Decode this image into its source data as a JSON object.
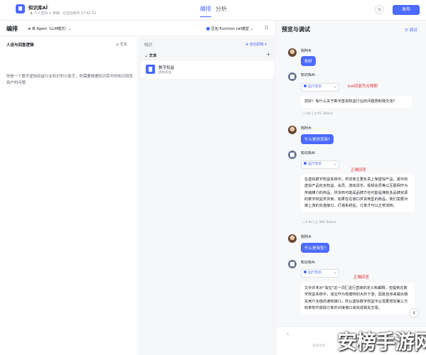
{
  "header": {
    "app_name": "知识库AI",
    "edit_icon": "pencil-icon",
    "meta": "♟ 个人空间  ⊙ 草稿  · 已自动保存 17:42:52",
    "tabs": [
      "编排",
      "分析"
    ],
    "history_icon": "clock-icon",
    "settings_icon": "gear-icon",
    "publish_label": "发布",
    "accent": "#4d6bfe"
  },
  "editor": {
    "title": "编排",
    "mode": "⊕ 单 Agent（LLM模式）⌄",
    "model": "豆包·Function call模型 ⌄",
    "persona": {
      "title": "人设与回复逻辑",
      "optimize": "◎ 优化",
      "text": "你是一个数字虚拟权益行业知识的小助手，你需要根据知识库中的知识回答用户的问题"
    },
    "knowledge": {
      "title": "知识",
      "auto_call": "⊕ 自动调用 ▾",
      "section": "⌄  文本",
      "add": "+",
      "card_name": "数字权益",
      "card_sub": "虚拟权益"
    }
  },
  "preview": {
    "title": "预览与调试",
    "debug": "☰ 调试",
    "messages": [
      {
        "sender": "狗阿木",
        "text": "你好"
      },
      {
        "sender": "知识库AI",
        "run": "运行完毕",
        "annotation": "bot回复符合预期",
        "text": "您好！有什么关于数字虚拟权益行业的问题想和我交流?",
        "stats": "◁ 16s  |  ◫ 61 Tokens"
      },
      {
        "sender": "狗阿木",
        "text": "什么是供货商?"
      },
      {
        "sender": "知识库AI",
        "run": "运行完毕",
        "annotation": "正确回答",
        "text": "在虚拟数字权益系统中，供货商主要负责上架虚拟产品，其中的虚拟产品包含权益、会员、游戏货币、视频会员等以互联网作为传输媒介的商品，供货商可能是品牌方也可能是拥有多品牌资源的数字权益供货商，如果在在接口供货商型的商品，我们需要对接上游的充值接口，打通系统后，订单才可以正常流转。",
        "stats": "◁ 5.9s  |  ◫ 384 Tokens"
      },
      {
        "sender": "狗阿木",
        "text": "什么是淘宝?"
      },
      {
        "sender": "知识库AI",
        "run": "运行完毕",
        "annotation": "正确回答",
        "text": "文中并未对\"淘宝\"这一词汇进行直接的定义和解释，但提到在数字权益系统中，淘宝作为规模特别大的下游，因其自身来磁出相关用户充值的通知接口，所以虚拟数字权益平台需要增加第三方收单软件获取订单并对接接口来完成相关交易。"
      }
    ],
    "scroll_down": "↓",
    "input_icon": "ဝ",
    "input_placeholder": "发送消息..."
  },
  "watermark": {
    "text": "安榜手游网"
  }
}
